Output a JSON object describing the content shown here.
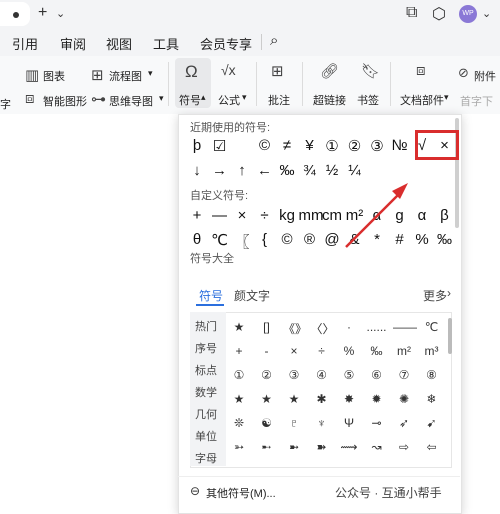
{
  "tab_bar": {
    "new_tab": "+",
    "tab_menu": "⌄",
    "avatar_text": "WP"
  },
  "menu": {
    "items": [
      "引用",
      "审阅",
      "视图",
      "工具",
      "会员专享"
    ]
  },
  "ribbon": {
    "chart": "图表",
    "flowchart": "流程图",
    "smart_shape": "智能图形",
    "mindmap": "思维导图",
    "symbol": "符号",
    "formula": "公式",
    "annotation": "批注",
    "hyperlink": "超链接",
    "bookmark": "书签",
    "doc_parts": "文档部件",
    "attachment": "附件",
    "dropcap": "首字下",
    "left_fragment": "字"
  },
  "symbol_panel": {
    "recent_title": "近期使用的符号:",
    "recent_row1": [
      "þ",
      "☑",
      "",
      "©",
      "≠",
      "¥",
      "①",
      "②",
      "③",
      "№",
      "√",
      "×"
    ],
    "recent_row2": [
      "↓",
      "→",
      "↑",
      "←",
      "‰",
      "¾",
      "½",
      "¼"
    ],
    "custom_title": "自定义符号:",
    "custom_row1": [
      "+",
      "—",
      "×",
      "÷",
      "kg",
      "mm",
      "cm",
      "m²",
      "α",
      "ɡ",
      "α",
      "β"
    ],
    "custom_row2": [
      "θ",
      "℃",
      "〖",
      "{",
      "©",
      "®",
      "@",
      "&",
      "*",
      "#",
      "%",
      "‰"
    ],
    "all_title": "符号大全",
    "tabs": [
      "符号",
      "颜文字"
    ],
    "more": "更多",
    "categories": [
      "热门",
      "序号",
      "标点",
      "数学",
      "几何",
      "单位",
      "字母"
    ],
    "grid": [
      [
        "★",
        "[]",
        "《》",
        "〈〉",
        "·",
        "......",
        "——",
        "℃"
      ],
      [
        "+",
        "-",
        "×",
        "÷",
        "%",
        "‰",
        "m²",
        "m³"
      ],
      [
        "①",
        "②",
        "③",
        "④",
        "⑤",
        "⑥",
        "⑦",
        "⑧"
      ],
      [
        "★",
        "★",
        "★",
        "✱",
        "✸",
        "✹",
        "✺",
        "❄"
      ],
      [
        "❊",
        "☯",
        "♇",
        "♆",
        "Ψ",
        "⊸",
        "➶",
        "➹"
      ],
      [
        "➳",
        "➸",
        "➼",
        "➽",
        "⟿",
        "↝",
        "⇨",
        "⇦"
      ]
    ],
    "other_symbols": "其他符号(M)...",
    "highlight_color": "#d92d2d",
    "accent_color": "#2b6fde"
  },
  "watermark": "公众号 · 互通小帮手"
}
